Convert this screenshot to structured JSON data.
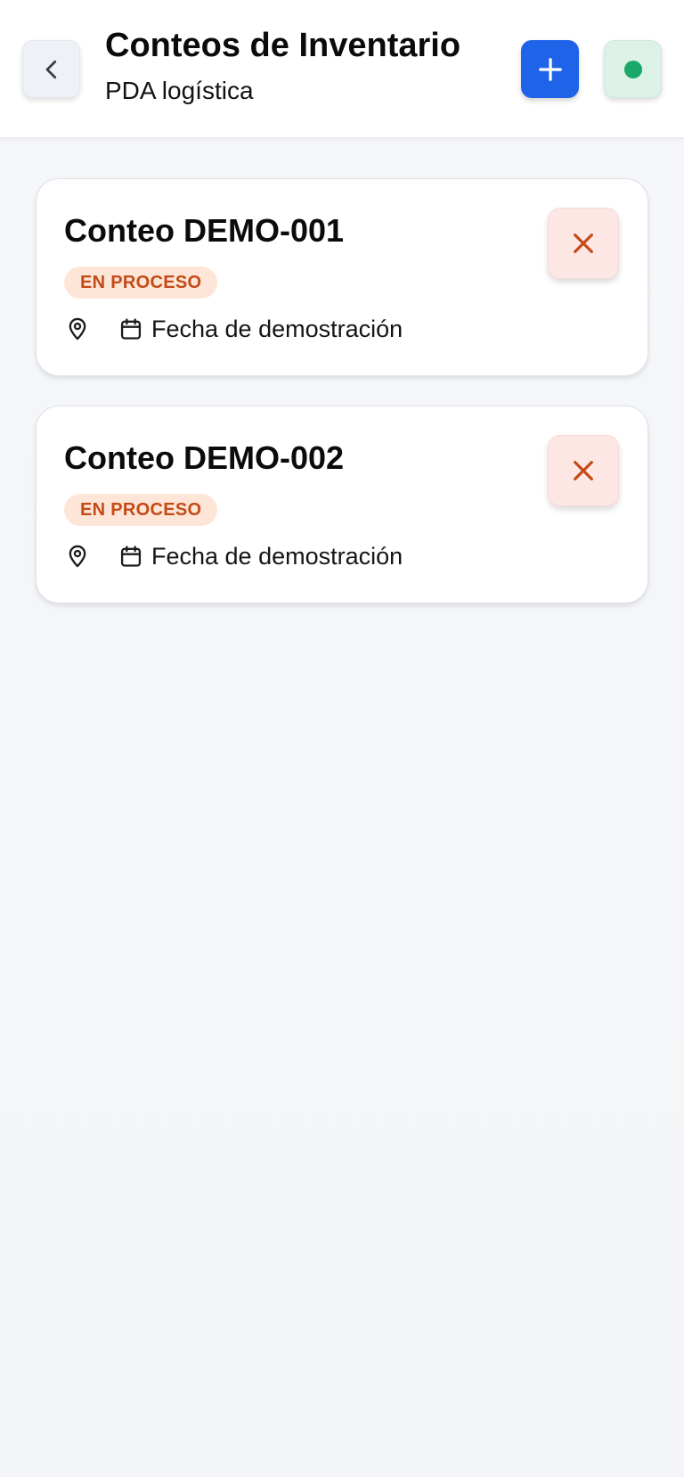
{
  "header": {
    "title": "Conteos de Inventario",
    "subtitle": "PDA logística",
    "back_icon": "chevron-left-icon",
    "add_icon": "plus-icon",
    "status_icon": "status-dot-icon"
  },
  "colors": {
    "primary": "#1f63e9",
    "status_online": "#1aa86a",
    "badge_bg": "#fde6d8",
    "badge_text": "#c44a17",
    "delete_bg": "#fde7e4",
    "delete_icon": "#c44a17"
  },
  "counts": [
    {
      "title": "Conteo DEMO-001",
      "status": "EN PROCESO",
      "date": "Fecha de demostración",
      "location_icon": "map-pin-icon",
      "date_icon": "calendar-icon",
      "delete_icon": "close-icon"
    },
    {
      "title": "Conteo DEMO-002",
      "status": "EN PROCESO",
      "date": "Fecha de demostración",
      "location_icon": "map-pin-icon",
      "date_icon": "calendar-icon",
      "delete_icon": "close-icon"
    }
  ]
}
